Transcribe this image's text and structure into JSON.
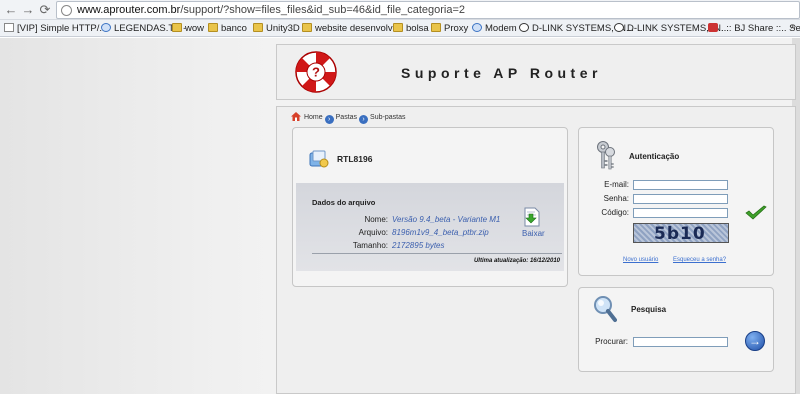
{
  "browser": {
    "url_host": "www.aprouter.com.br",
    "url_path": "/support/?show=files_files&id_sub=46&id_file_categoria=2",
    "bookmarks": [
      {
        "label": "[VIP] Simple HTTP/...",
        "icon": "doc-icon"
      },
      {
        "label": "LEGENDAS.TV -",
        "icon": "globe-icon"
      },
      {
        "label": "wow",
        "icon": "folder-icon"
      },
      {
        "label": "banco",
        "icon": "folder-icon"
      },
      {
        "label": "Unity3D",
        "icon": "folder-icon"
      },
      {
        "label": "website desenvolvi...",
        "icon": "folder-icon"
      },
      {
        "label": "bolsa",
        "icon": "folder-icon"
      },
      {
        "label": "Proxy",
        "icon": "folder-icon"
      },
      {
        "label": "Modem",
        "icon": "globe-icon"
      },
      {
        "label": "D-LINK SYSTEMS, IN...",
        "icon": "dlink-icon"
      },
      {
        "label": "D-LINK SYSTEMS, IN...",
        "icon": "dlink-icon"
      },
      {
        "label": "..:: BJ Share ::.. Semea...",
        "icon": "red-icon"
      }
    ],
    "bookmarks_more": "»"
  },
  "header": {
    "title": "Suporte AP Router"
  },
  "breadcrumb": {
    "home": "Home",
    "folders": "Pastas",
    "subfolders": "Sub-pastas"
  },
  "file": {
    "name": "RTL8196",
    "details_title": "Dados do arquivo",
    "name_label": "Nome:",
    "name_value": "Versão 9.4_beta - Variante M1",
    "file_label": "Arquivo:",
    "file_value": "8196m1v9_4_beta_ptbr.zip",
    "size_label": "Tamanho:",
    "size_value": "2172895 bytes",
    "download_label": "Baixar",
    "updated": "Ultima atualização: 16/12/2010"
  },
  "auth": {
    "title": "Autenticação",
    "email_label": "E-mail:",
    "password_label": "Senha:",
    "code_label": "Código:",
    "captcha_text": "5b10",
    "new_user_link": "Novo usuário",
    "forgot_link": "Esqueceu a senha?"
  },
  "search": {
    "title": "Pesquisa",
    "label": "Procurar:",
    "button": "→"
  }
}
